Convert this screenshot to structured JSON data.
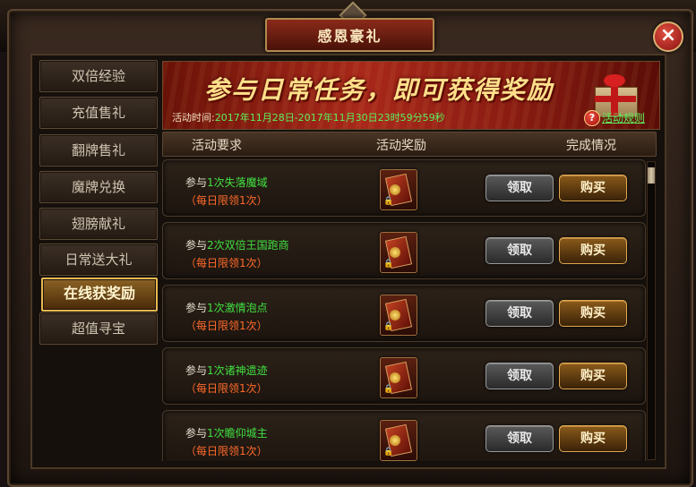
{
  "window": {
    "title": "感恩豪礼",
    "close_icon": "×"
  },
  "sidebar": {
    "items": [
      {
        "label": "双倍经验"
      },
      {
        "label": "充值售礼"
      },
      {
        "label": "翻牌售礼"
      },
      {
        "label": "魔牌兑换"
      },
      {
        "label": "翅膀献礼"
      },
      {
        "label": "日常送大礼"
      },
      {
        "label": "在线获奖励",
        "active": true
      },
      {
        "label": "超值寻宝"
      }
    ]
  },
  "banner": {
    "headline": "参与日常任务，即可获得奖励",
    "time_label": "活动时间:",
    "time_value": "2017年11月28日-2017年11月30日23时59分59秒",
    "help_icon": "?",
    "rules_link": "活动规则"
  },
  "columns": {
    "requirement": "活动要求",
    "reward": "活动奖励",
    "status": "完成情况"
  },
  "tasks": [
    {
      "prefix": "参与",
      "highlight": "1次失落魔域",
      "limit": "（每日限领1次）",
      "claim": "领取",
      "buy": "购买"
    },
    {
      "prefix": "参与",
      "highlight": "2次双倍王国跑商",
      "limit": "（每日限领1次）",
      "claim": "领取",
      "buy": "购买"
    },
    {
      "prefix": "参与",
      "highlight": "1次激情泡点",
      "limit": "（每日限领1次）",
      "claim": "领取",
      "buy": "购买"
    },
    {
      "prefix": "参与",
      "highlight": "1次诸神遗迹",
      "limit": "（每日限领1次）",
      "claim": "领取",
      "buy": "购买"
    },
    {
      "prefix": "参与",
      "highlight": "1次瞻仰城主",
      "limit": "（每日限领1次）",
      "claim": "领取",
      "buy": "购买"
    }
  ],
  "colors": {
    "highlight_green": "#40e040",
    "limit_orange": "#ff6a2a",
    "active_gold": "#e8b850"
  }
}
